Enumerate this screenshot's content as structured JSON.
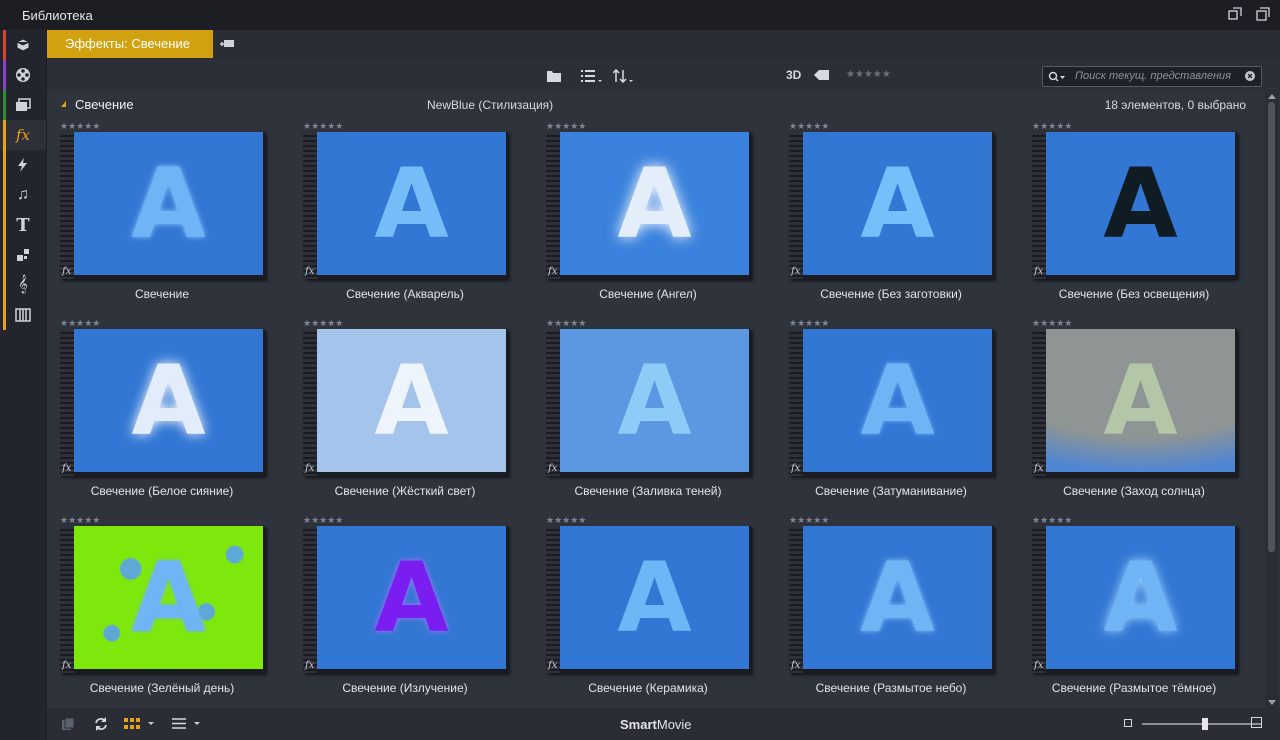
{
  "window": {
    "title": "Библиотека"
  },
  "sidebar": {
    "items": [
      {
        "icon": "box-icon",
        "color": "#d9422f"
      },
      {
        "icon": "film-reel-icon",
        "color": "#8a3fc8"
      },
      {
        "icon": "clips-icon",
        "color": "#2f8b2f"
      },
      {
        "icon": "fx-icon",
        "color": "#e8a31a",
        "active": true
      },
      {
        "icon": "transition-icon",
        "color": "#e8a31a"
      },
      {
        "icon": "music-icon",
        "color": "#e8a31a"
      },
      {
        "icon": "title-icon",
        "color": "#e8a31a"
      },
      {
        "icon": "montage-icon",
        "color": "#e8a31a"
      },
      {
        "icon": "score-icon",
        "color": "#e8a31a"
      },
      {
        "icon": "piano-icon",
        "color": "#e8a31a"
      }
    ]
  },
  "tabbar": {
    "active_tab": "Эффекты: Свечение"
  },
  "toolbar": {
    "label_3d": "3D",
    "rating_stars": "★★★★★",
    "search_placeholder": "Поиск текущ. представления"
  },
  "group": {
    "name": "Свечение",
    "category": "NewBlue (Стилизация)",
    "count": "18 элементов, 0 выбрано"
  },
  "items": [
    {
      "label": "Свечение",
      "bg": "#3277d4",
      "fg": "#6fb4f4",
      "glow": "0 0 6px #8cc8ff",
      "stars": "★★★★★"
    },
    {
      "label": "Свечение (Акварель)",
      "bg": "#3277d4",
      "fg": "#74bdf8",
      "glow": "none",
      "stars": "★★★★★"
    },
    {
      "label": "Свечение (Ангел)",
      "bg": "#3a82dd",
      "fg": "#e4eefb",
      "glow": "0 0 14px #ffffff",
      "stars": "★★★★★"
    },
    {
      "label": "Свечение (Без заготовки)",
      "bg": "#3277d4",
      "fg": "#74c0fa",
      "glow": "none",
      "stars": "★★★★★"
    },
    {
      "label": "Свечение (Без освещения)",
      "bg": "#3277d4",
      "fg": "#0f1c24",
      "glow": "none",
      "stars": "★★★★★"
    },
    {
      "label": "Свечение (Белое сияние)",
      "bg": "#3277d4",
      "fg": "#e2ecfa",
      "glow": "0 0 12px #ffffff",
      "stars": "★★★★★"
    },
    {
      "label": "Свечение (Жёсткий свет)",
      "bg": "#a5c4ec",
      "fg": "#eef4fc",
      "glow": "none",
      "stars": "★★★★★"
    },
    {
      "label": "Свечение (Заливка теней)",
      "bg": "#5c98e2",
      "fg": "#8ecbf7",
      "glow": "none",
      "stars": "★★★★★"
    },
    {
      "label": "Свечение (Затуманивание)",
      "bg": "#3277d4",
      "fg": "#6fb4f4",
      "glow": "0 0 5px #6fb4f4",
      "stars": "★★★★★"
    },
    {
      "label": "Свечение (Заход солнца)",
      "bg": "#8e9594",
      "fg": "#b4c6a8",
      "glow": "none",
      "stars": "★★★★★"
    },
    {
      "label": "Свечение (Зелёный день)",
      "bg": "#7ee80c",
      "fg": "#6fb4f4",
      "glow": "0 0 4px #6fb4f4",
      "stars": "★★★★★"
    },
    {
      "label": "Свечение (Излучение)",
      "bg": "#3277d4",
      "fg": "#7a1df0",
      "glow": "0 0 6px #b070ff",
      "stars": "★★★★★"
    },
    {
      "label": "Свечение (Керамика)",
      "bg": "#3277d4",
      "fg": "#6cb8f6",
      "glow": "none",
      "stars": "★★★★★"
    },
    {
      "label": "Свечение (Размытое небо)",
      "bg": "#3277d4",
      "fg": "#6fb4f4",
      "glow": "0 0 6px #8cc8ff",
      "stars": "★★★★★"
    },
    {
      "label": "Свечение (Размытое тёмное)",
      "bg": "#3277d4",
      "fg": "#6fb4f4",
      "glow": "0 0 10px #a0d4ff",
      "stars": "★★★★★"
    }
  ],
  "thumb_letter": "A",
  "fx_mark": "fx",
  "bottombar": {
    "brand_bold": "Smart",
    "brand_rest": "Movie"
  }
}
